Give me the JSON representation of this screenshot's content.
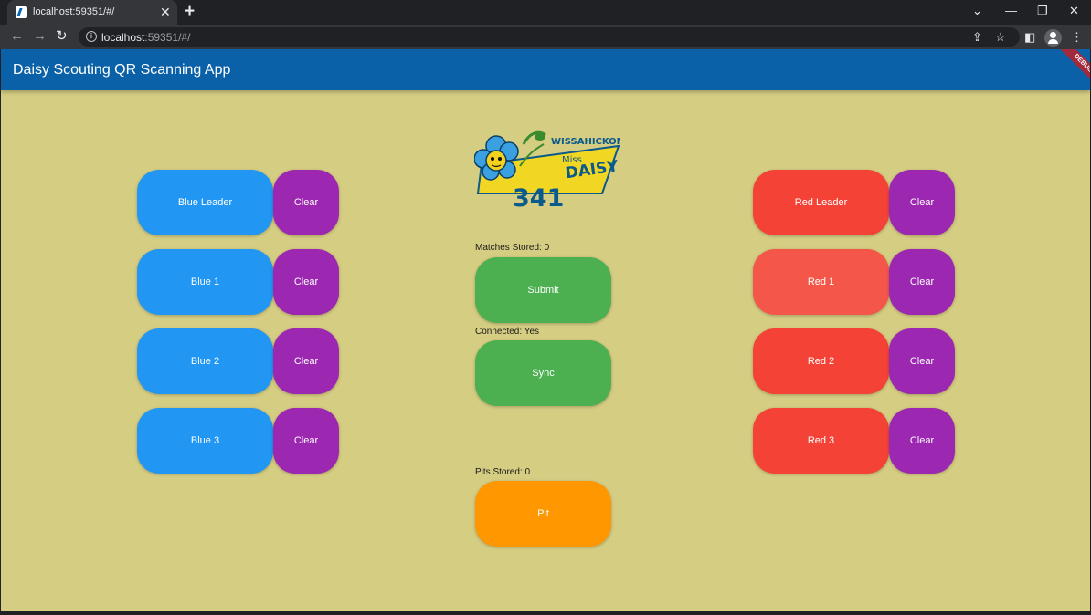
{
  "browser": {
    "tab_title": "localhost:59351/#/",
    "tab_close": "✕",
    "new_tab": "+",
    "url_host": "localhost",
    "url_rest": ":59351/#/"
  },
  "app": {
    "title": "Daisy Scouting QR Scanning App",
    "debug_banner": "DEBUG",
    "logo": {
      "line1": "WISSAHICKON",
      "line2": "Miss",
      "line3": "DAISY",
      "number": "341"
    },
    "blue": {
      "leader": "Blue Leader",
      "b1": "Blue 1",
      "b2": "Blue 2",
      "b3": "Blue 3"
    },
    "red": {
      "leader": "Red Leader",
      "r1": "Red 1",
      "r2": "Red 2",
      "r3": "Red 3"
    },
    "clear_label": "Clear",
    "matches_stored": "Matches Stored: 0",
    "submit": "Submit",
    "connected": "Connected: Yes",
    "sync": "Sync",
    "pits_stored": "Pits Stored: 0",
    "pit": "Pit",
    "colors": {
      "appbar": "#0a61a8",
      "background": "#d5cd82",
      "blue": "#2196f3",
      "red": "#f44336",
      "clear": "#9c27b0",
      "green": "#4caf50",
      "orange": "#ff9800"
    }
  }
}
